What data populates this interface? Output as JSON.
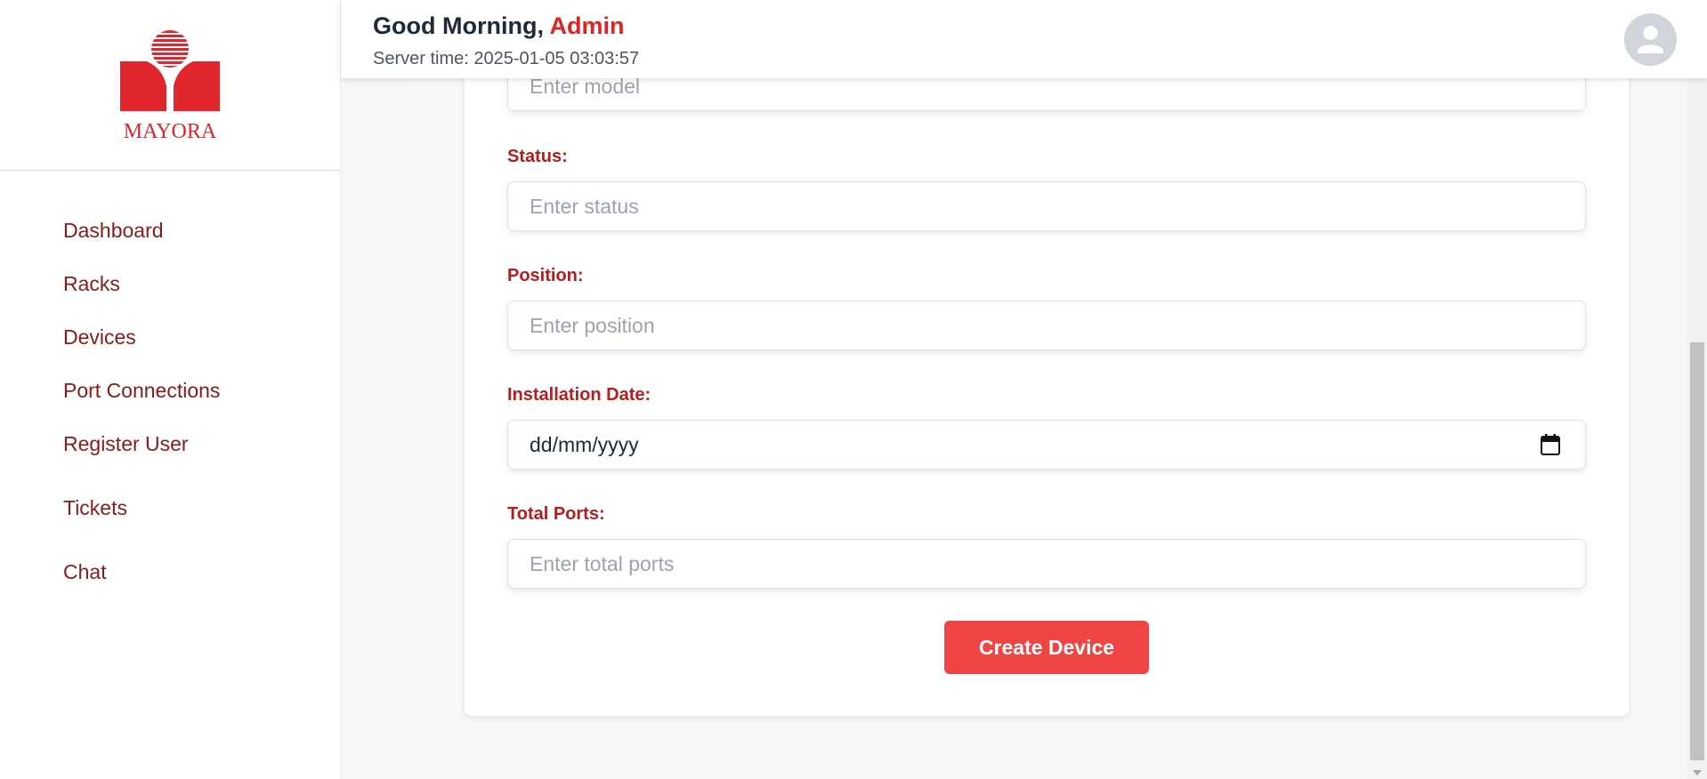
{
  "logo": {
    "text": "MAYORA",
    "color": "#e1262d"
  },
  "sidebar": {
    "items": [
      {
        "label": "Dashboard"
      },
      {
        "label": "Racks"
      },
      {
        "label": "Devices"
      },
      {
        "label": "Port Connections"
      },
      {
        "label": "Register User"
      },
      {
        "label": "Tickets"
      },
      {
        "label": "Chat"
      }
    ]
  },
  "header": {
    "greeting": "Good Morning, ",
    "user_name": "Admin",
    "server_time": "Server time: 2025-01-05 03:03:57",
    "avatar_icon": "user-avatar-icon"
  },
  "form": {
    "model": {
      "placeholder": "Enter model"
    },
    "status": {
      "label": "Status:",
      "placeholder": "Enter status"
    },
    "position": {
      "label": "Position:",
      "placeholder": "Enter position"
    },
    "installation_date": {
      "label": "Installation Date:",
      "value": "dd/mm/yyyy",
      "icon": "calendar-icon"
    },
    "total_ports": {
      "label": "Total Ports:",
      "placeholder": "Enter total ports"
    },
    "submit_label": "Create Device"
  },
  "colors": {
    "accent": "#ef4444",
    "label": "#b91c1c",
    "nav_text": "#8b1a1a"
  }
}
